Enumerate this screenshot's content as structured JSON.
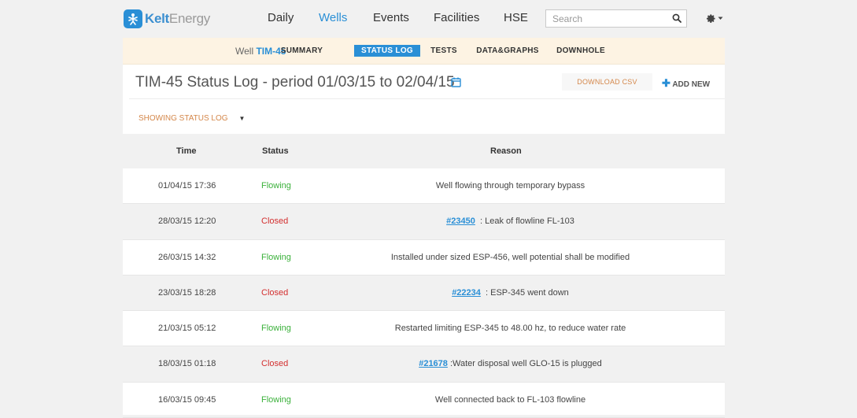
{
  "brand": {
    "name_bold": "Kelt",
    "name_light": "Energy",
    "logo_icon": "kelt-logo-icon"
  },
  "nav": [
    {
      "label": "Daily",
      "active": false
    },
    {
      "label": "Wells",
      "active": true
    },
    {
      "label": "Events",
      "active": false
    },
    {
      "label": "Facilities",
      "active": false
    },
    {
      "label": "HSE",
      "active": false
    }
  ],
  "search": {
    "placeholder": "Search",
    "value": ""
  },
  "well": {
    "prefix": "Well",
    "name": "TIM-45"
  },
  "tabs": [
    {
      "label": "SUMMARY",
      "active": false
    },
    {
      "label": "STATUS LOG",
      "active": true
    },
    {
      "label": "TESTS",
      "active": false
    },
    {
      "label": "DATA&GRAPHS",
      "active": false
    },
    {
      "label": "DOWNHOLE",
      "active": false
    }
  ],
  "page": {
    "title": "TIM-45 Status Log - period 01/03/15 to 02/04/15",
    "download_label": "DOWNLOAD CSV",
    "add_label": "ADD NEW",
    "filter_label": "SHOWING STATUS LOG",
    "filter_caret": "▼"
  },
  "table": {
    "columns": [
      "Time",
      "Status",
      "Reason"
    ],
    "rows": [
      {
        "time": "01/04/15 17:36",
        "status": "Flowing",
        "link": "",
        "reason": "Well flowing through temporary bypass"
      },
      {
        "time": "28/03/15 12:20",
        "status": "Closed",
        "link": "#23450",
        "reason": "  : Leak of flowline FL-103"
      },
      {
        "time": "26/03/15 14:32",
        "status": "Flowing",
        "link": "",
        "reason": "Installed under sized ESP-456, well potential shall be modified"
      },
      {
        "time": "23/03/15 18:28",
        "status": "Closed",
        "link": "#22234",
        "reason": "  : ESP-345 went down"
      },
      {
        "time": "21/03/15 05:12",
        "status": "Flowing",
        "link": "",
        "reason": "Restarted limiting ESP-345 to 48.00 hz, to reduce water rate"
      },
      {
        "time": "18/03/15 01:18",
        "status": "Closed",
        "link": "#21678",
        "reason": " :Water disposal well GLO-15 is plugged"
      },
      {
        "time": "16/03/15 09:45",
        "status": "Flowing",
        "link": "",
        "reason": "Well connected back to FL-103 flowline"
      }
    ]
  },
  "colors": {
    "accent": "#2a8fd6",
    "flowing": "#3bb13b",
    "closed": "#d32f2f",
    "subnav_bg": "#fdf3e3",
    "csv": "#d4874a"
  }
}
